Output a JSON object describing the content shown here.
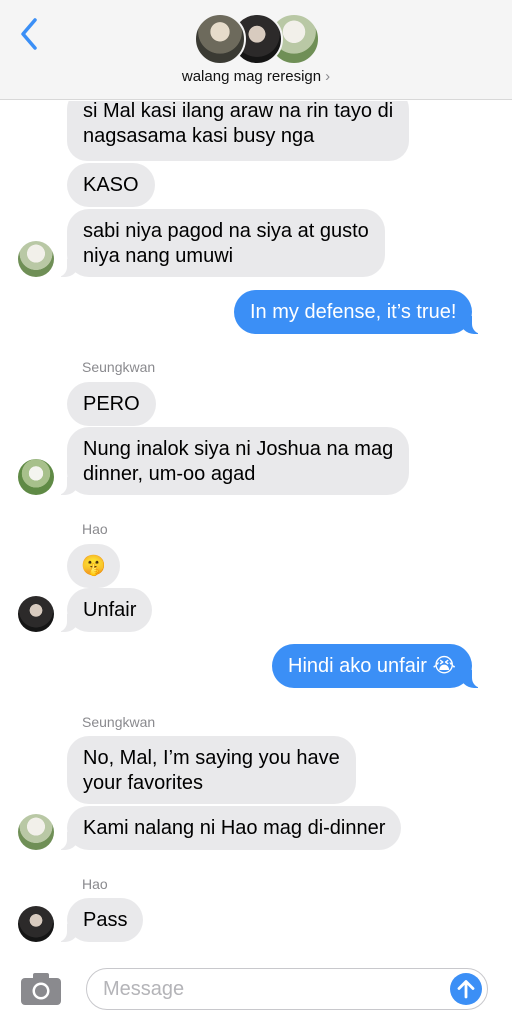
{
  "header": {
    "group_name": "walang mag reresign",
    "chevron": "›",
    "back_icon": "chevron-left-icon",
    "accent": "#3b8ff6"
  },
  "messages": [
    {
      "from": "them",
      "text": "si Mal kasi ilang araw na rin tayo di"
    },
    {
      "from": "them",
      "text": "nagsasama kasi busy nga"
    },
    {
      "from": "them",
      "text": "KASO"
    },
    {
      "from": "them",
      "text": "sabi niya pagod na siya at gusto"
    },
    {
      "from": "them",
      "text": "niya nang umuwi"
    },
    {
      "from": "me",
      "text": "In my defense, it’s true!"
    },
    {
      "sender": "Seungkwan"
    },
    {
      "from": "them",
      "text": "PERO"
    },
    {
      "from": "them",
      "text": "Nung inalok siya ni Joshua na mag"
    },
    {
      "from": "them",
      "text": "dinner, um-oo agad"
    },
    {
      "sender": "Hao"
    },
    {
      "from": "them",
      "text": "🤫"
    },
    {
      "from": "them",
      "text": "Unfair"
    },
    {
      "from": "me",
      "text": "Hindi ako unfair 😭"
    },
    {
      "sender": "Seungkwan"
    },
    {
      "from": "them",
      "text": "No, Mal, I’m saying you have"
    },
    {
      "from": "them",
      "text": "your favorites"
    },
    {
      "from": "them",
      "text": "Kami nalang ni Hao mag di-dinner"
    },
    {
      "sender": "Hao"
    },
    {
      "from": "them",
      "text": "Pass"
    }
  ],
  "composer": {
    "placeholder": "Message",
    "camera_icon": "camera-icon",
    "send_icon": "arrow-up-icon"
  },
  "colors": {
    "incoming_bubble": "#e9e9eb",
    "outgoing_bubble": "#3b8ff6",
    "sender_label": "#8a8a8e"
  }
}
